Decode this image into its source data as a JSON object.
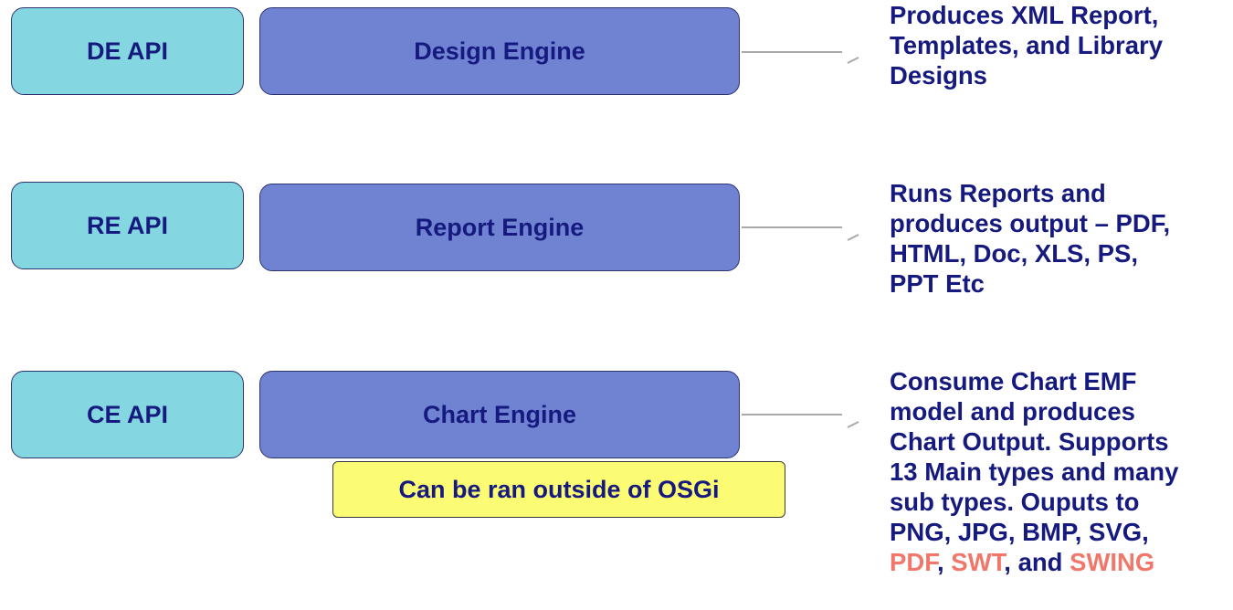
{
  "rows": [
    {
      "api": "DE API",
      "engine": "Design Engine",
      "desc_lines": [
        "Produces XML Report,",
        "Templates, and Library",
        "Designs"
      ]
    },
    {
      "api": "RE API",
      "engine": "Report Engine",
      "desc_lines": [
        "Runs Reports and",
        "produces output – PDF,",
        "HTML, Doc, XLS, PS,",
        "PPT Etc"
      ]
    },
    {
      "api": "CE API",
      "engine": "Chart Engine",
      "desc_lines": [
        "Consume Chart EMF",
        "model and produces",
        "Chart Output.  Supports",
        "13 Main types and many",
        "sub types.  Ouputs to",
        "PNG, JPG, BMP, SVG,"
      ],
      "desc_last": {
        "hl1": "PDF",
        "sep1": ", ",
        "hl2": "SWT",
        "sep2": ", and ",
        "hl3": "SWING"
      }
    }
  ],
  "note": "Can be ran outside of OSGi",
  "colors": {
    "api_fill": "#84d6e1",
    "engine_fill": "#7083d2",
    "note_fill": "#fbfb74",
    "text": "#161a7e",
    "highlight": "#f2776b"
  }
}
